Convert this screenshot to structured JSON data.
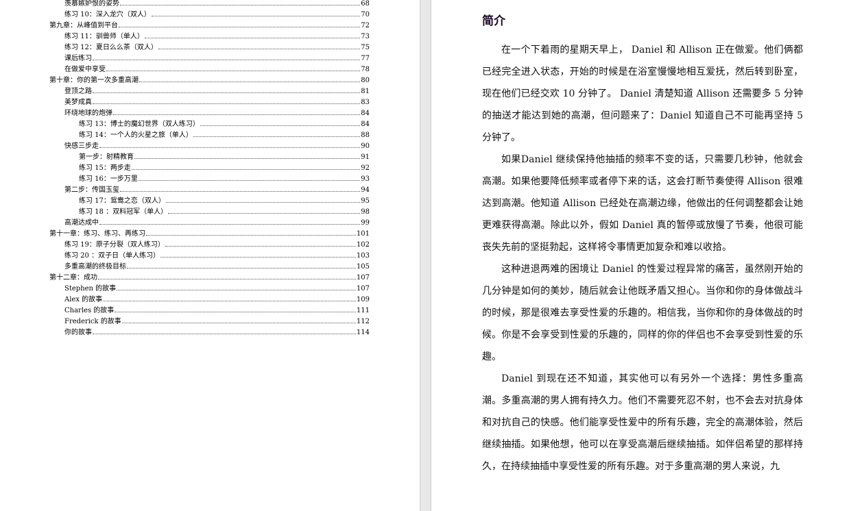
{
  "toc": [
    {
      "level": 1,
      "title": "羡慕嫉妒恨的姿势",
      "page": "68"
    },
    {
      "level": 1,
      "title": "练习 10：深入龙穴（双人）",
      "page": "70"
    },
    {
      "level": 0,
      "title": "第九章：从峰值到平台",
      "page": "72"
    },
    {
      "level": 1,
      "title": "练习 11：驯兽师（单人）",
      "page": "73"
    },
    {
      "level": 1,
      "title": "练习 12：夏日么么茶（双人）",
      "page": "75"
    },
    {
      "level": 1,
      "title": "课后练习",
      "page": "77"
    },
    {
      "level": 1,
      "title": "在做爱中享受",
      "page": "78"
    },
    {
      "level": 0,
      "title": "第十章：你的第一次多重高潮",
      "page": "80"
    },
    {
      "level": 1,
      "title": "登顶之路",
      "page": "81"
    },
    {
      "level": 1,
      "title": "美梦成真",
      "page": "83"
    },
    {
      "level": 1,
      "title": "环绕地球的炮弹",
      "page": "84"
    },
    {
      "level": 2,
      "title": "练习 13：博士的魔幻世界（双人练习）",
      "page": "84"
    },
    {
      "level": 2,
      "title": "练习 14：一个人的火星之旅（单人）",
      "page": "88"
    },
    {
      "level": 1,
      "title": "快感三步走",
      "page": "90"
    },
    {
      "level": 2,
      "title": "第一步：射精教育",
      "page": "91"
    },
    {
      "level": 2,
      "title": "练习 15：两步走",
      "page": "92"
    },
    {
      "level": 2,
      "title": "练习 16：一步万里",
      "page": "93"
    },
    {
      "level": 1,
      "title": "第二步：传国玉玺",
      "page": "94"
    },
    {
      "level": 2,
      "title": "练习 17：鸳鸯之恋（双人）",
      "page": "95"
    },
    {
      "level": 2,
      "title": "练习 18 ：双料冠军（单人）",
      "page": "98"
    },
    {
      "level": 1,
      "title": "高潮达成中",
      "page": "99"
    },
    {
      "level": 0,
      "title": "第十一章：练习、练习、再练习",
      "page": "101"
    },
    {
      "level": 1,
      "title": "练习 19：原子分裂（双人练习）",
      "page": "102"
    },
    {
      "level": 1,
      "title": "练习 20 ：双子日（单人练习）",
      "page": "103"
    },
    {
      "level": 1,
      "title": "多重高潮的终极目标",
      "page": "105"
    },
    {
      "level": 0,
      "title": "第十二章：成功",
      "page": "107"
    },
    {
      "level": 1,
      "title": "Stephen 的故事",
      "page": "107"
    },
    {
      "level": 1,
      "title": "Alex 的故事",
      "page": "109"
    },
    {
      "level": 1,
      "title": "Charles 的故事",
      "page": "111"
    },
    {
      "level": 1,
      "title": "Frederick 的故事",
      "page": "112"
    },
    {
      "level": 1,
      "title": "你的故事",
      "page": "114"
    }
  ],
  "right_page": {
    "heading": "简介",
    "paragraphs": [
      "在一个下着雨的星期天早上， Daniel 和 Allison 正在做爱。他们俩都已经完全进入状态，开始的时候是在浴室慢慢地相互爱抚，然后转到卧室，现在他们已经交欢 10 分钟了。 Daniel 清楚知道 Allison 还需要多 5 分钟的抽送才能达到她的高潮，但问题来了：Daniel 知道自己不可能再坚持 5 分钟了。",
      "如果Daniel 继续保持他抽插的频率不变的话，只需要几秒钟，他就会高潮。如果他要降低频率或者停下来的话，这会打断节奏使得 Allison 很难达到高潮。他知道 Allison 已经处在高潮边缘，他做出的任何调整都会让她更难获得高潮。除此以外，假如 Daniel 真的暂停或放慢了节奏，他很可能丧失先前的坚挺勃起，这样将令事情更加复杂和难以收拾。",
      "这种进退两难的困境让 Daniel 的性爱过程异常的痛苦，虽然刚开始的几分钟是如何的美妙，随后就会让他既矛盾又担心。当你和你的身体做战斗的时候，那是很难去享受性爱的乐趣的。相信我，当你和你的身体做战的时候。你是不会享受到性爱的乐趣的，同样的你的伴侣也不会享受到性爱的乐趣。",
      "Daniel 到现在还不知道，其实他可以有另外一个选择：男性多重高潮。多重高潮的男人拥有持久力。他们不需要死忍不射，也不会去对抗身体和对抗自己的快感。他们能享受性爱中的所有乐趣，完全的高潮体验，然后继续抽插。如果他想，他可以在享受高潮后继续抽插。如伴侣希望的那样持久，在持续抽插中享受性爱的所有乐趣。对于多重高潮的男人来说，九"
    ]
  }
}
